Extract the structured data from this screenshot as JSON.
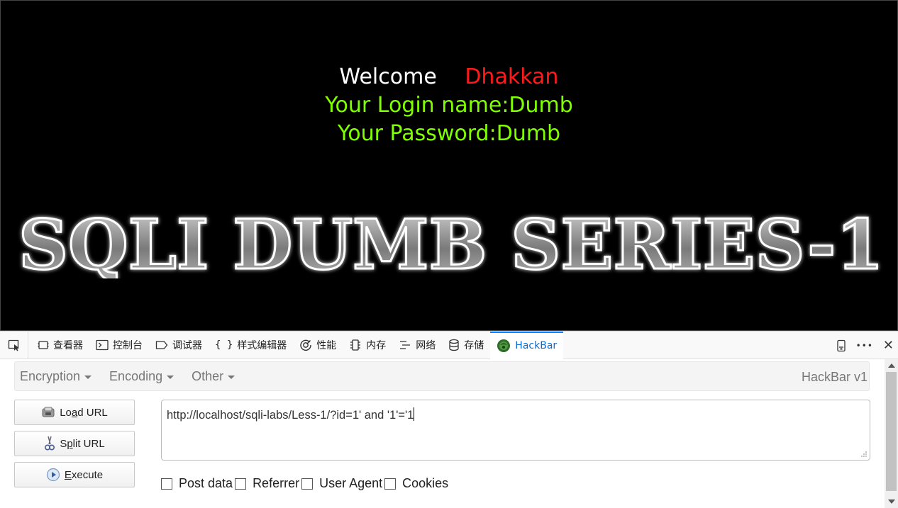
{
  "page": {
    "welcome": "Welcome",
    "name": "Dhakkan",
    "login_line": "Your Login name:Dumb",
    "password_line": "Your Password:Dumb",
    "banner_text": "SQLI DUMB SERIES-1"
  },
  "devtools": {
    "tabs": [
      {
        "label": "查看器",
        "icon": "inspector-icon"
      },
      {
        "label": "控制台",
        "icon": "console-icon"
      },
      {
        "label": "调试器",
        "icon": "debugger-icon"
      },
      {
        "label": "样式编辑器",
        "icon": "style-editor-icon"
      },
      {
        "label": "性能",
        "icon": "performance-icon"
      },
      {
        "label": "内存",
        "icon": "memory-icon"
      },
      {
        "label": "网络",
        "icon": "network-icon"
      },
      {
        "label": "存储",
        "icon": "storage-icon"
      },
      {
        "label": "HackBar",
        "icon": "hackbar-icon"
      }
    ],
    "active_tab": "HackBar",
    "style_editor_glyph": "{ }",
    "more_glyph": "•••",
    "close_glyph": "✕"
  },
  "hackbar": {
    "menus": [
      "Encryption",
      "Encoding",
      "Other"
    ],
    "version": "HackBar v1",
    "buttons": {
      "load": {
        "pre": "Lo",
        "ul": "a",
        "post": "d URL"
      },
      "split": {
        "pre": "S",
        "ul": "p",
        "post": "lit URL"
      },
      "execute": {
        "pre": "",
        "ul": "E",
        "post": "xecute"
      }
    },
    "url": "http://localhost/sqli-labs/Less-1/?id=1' and '1'='1",
    "options": [
      "Post data",
      "Referrer",
      "User Agent",
      "Cookies"
    ]
  },
  "colors": {
    "page_bg": "#000000",
    "name_red": "#ff1a1a",
    "login_green": "#7fff00",
    "active_tab_blue": "#0a84ff"
  }
}
